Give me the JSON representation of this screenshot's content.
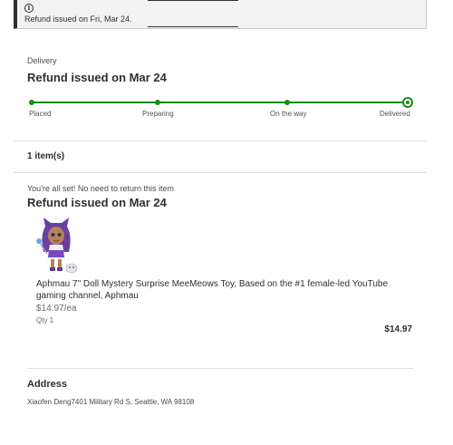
{
  "alert": {
    "icon": "info-icon",
    "text": "Refund issued on Fri, Mar 24."
  },
  "delivery": {
    "section_label": "Delivery",
    "heading": "Refund issued on Mar 24",
    "steps": [
      "Placed",
      "Preparing",
      "On the way",
      "Delivered"
    ],
    "current_step": "Delivered",
    "progress_color": "#1a8a1a"
  },
  "items": {
    "count_label": "1 item(s)",
    "return_note": "You're all set! No need to return this item",
    "refund_heading": "Refund issued on Mar 24",
    "product": {
      "title": "Aphmau 7\" Doll Mystery Surprise MeeMeows Toy, Based on the #1 female-led YouTube gaming channel, Aphmau",
      "unit_price": "$14.97/ea",
      "quantity": "Qty 1",
      "total": "$14.97"
    }
  },
  "address": {
    "heading": "Address",
    "text": "Xiaofen Deng7401 Military Rd S, Seattle, WA 98108"
  }
}
